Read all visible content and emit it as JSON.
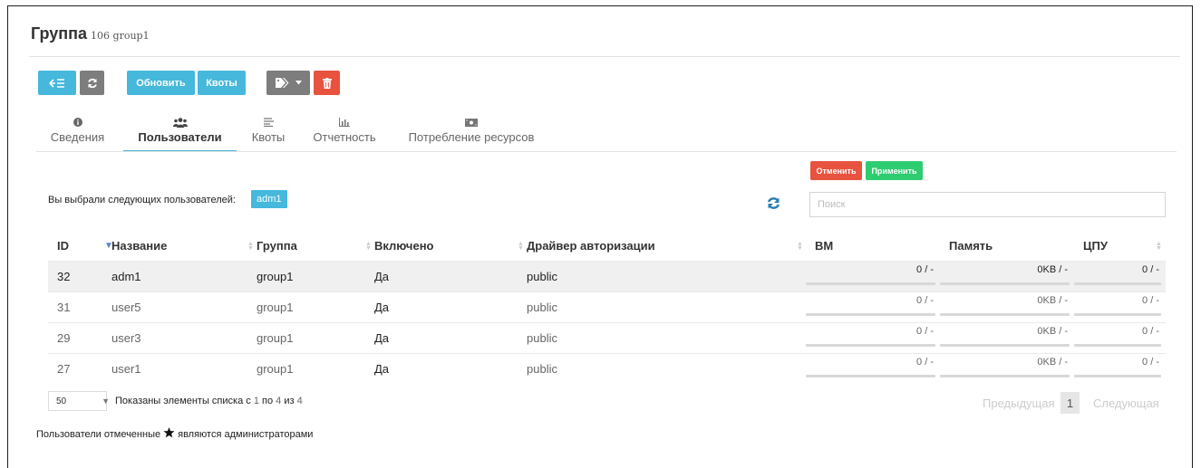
{
  "header": {
    "title": "Группа",
    "subtitle": "106 group1"
  },
  "toolbar": {
    "back_icon": "back-list-icon",
    "refresh_icon": "refresh-icon",
    "update_label": "Обновить",
    "quotas_label": "Квоты",
    "tag_icon": "tag-icon",
    "delete_icon": "trash-icon"
  },
  "tabs": [
    {
      "label": "Сведения",
      "icon": "info-icon"
    },
    {
      "label": "Пользователи",
      "icon": "users-icon"
    },
    {
      "label": "Квоты",
      "icon": "quotas-icon"
    },
    {
      "label": "Отчетность",
      "icon": "chart-icon"
    },
    {
      "label": "Потребление ресурсов",
      "icon": "money-icon"
    }
  ],
  "actions": {
    "cancel_label": "Отменить",
    "apply_label": "Применить"
  },
  "selection": {
    "label": "Вы выбрали следующих пользователей:",
    "users": [
      "adm1"
    ]
  },
  "search": {
    "placeholder": "Поиск",
    "value": ""
  },
  "table": {
    "columns": [
      "ID",
      "Название",
      "Группа",
      "Включено",
      "Драйвер авторизации",
      "ВМ",
      "Память",
      "ЦПУ"
    ],
    "rows": [
      {
        "id": "32",
        "name": "adm1",
        "group": "group1",
        "enabled": "Да",
        "driver": "public",
        "vm": "0 / -",
        "memory": "0KB / -",
        "cpu": "0 / -",
        "selected": true
      },
      {
        "id": "31",
        "name": "user5",
        "group": "group1",
        "enabled": "Да",
        "driver": "public",
        "vm": "0 / -",
        "memory": "0KB / -",
        "cpu": "0 / -",
        "selected": false
      },
      {
        "id": "29",
        "name": "user3",
        "group": "group1",
        "enabled": "Да",
        "driver": "public",
        "vm": "0 / -",
        "memory": "0KB / -",
        "cpu": "0 / -",
        "selected": false
      },
      {
        "id": "27",
        "name": "user1",
        "group": "group1",
        "enabled": "Да",
        "driver": "public",
        "vm": "0 / -",
        "memory": "0KB / -",
        "cpu": "0 / -",
        "selected": false
      }
    ]
  },
  "pagination": {
    "page_size": "50",
    "info_prefix": "Показаны элементы списка с",
    "from": "1",
    "to_word": "по",
    "to": "4",
    "of_word": "из",
    "total": "4",
    "prev_label": "Предыдущая",
    "current_page": "1",
    "next_label": "Следующая"
  },
  "footer": {
    "note_prefix": "Пользователи отмеченные",
    "note_suffix": "являются администраторами",
    "icon": "star-icon"
  },
  "colors": {
    "info": "#45b8db",
    "grey": "#7d7d7d",
    "danger": "#e8533f",
    "success": "#2ecc71"
  }
}
